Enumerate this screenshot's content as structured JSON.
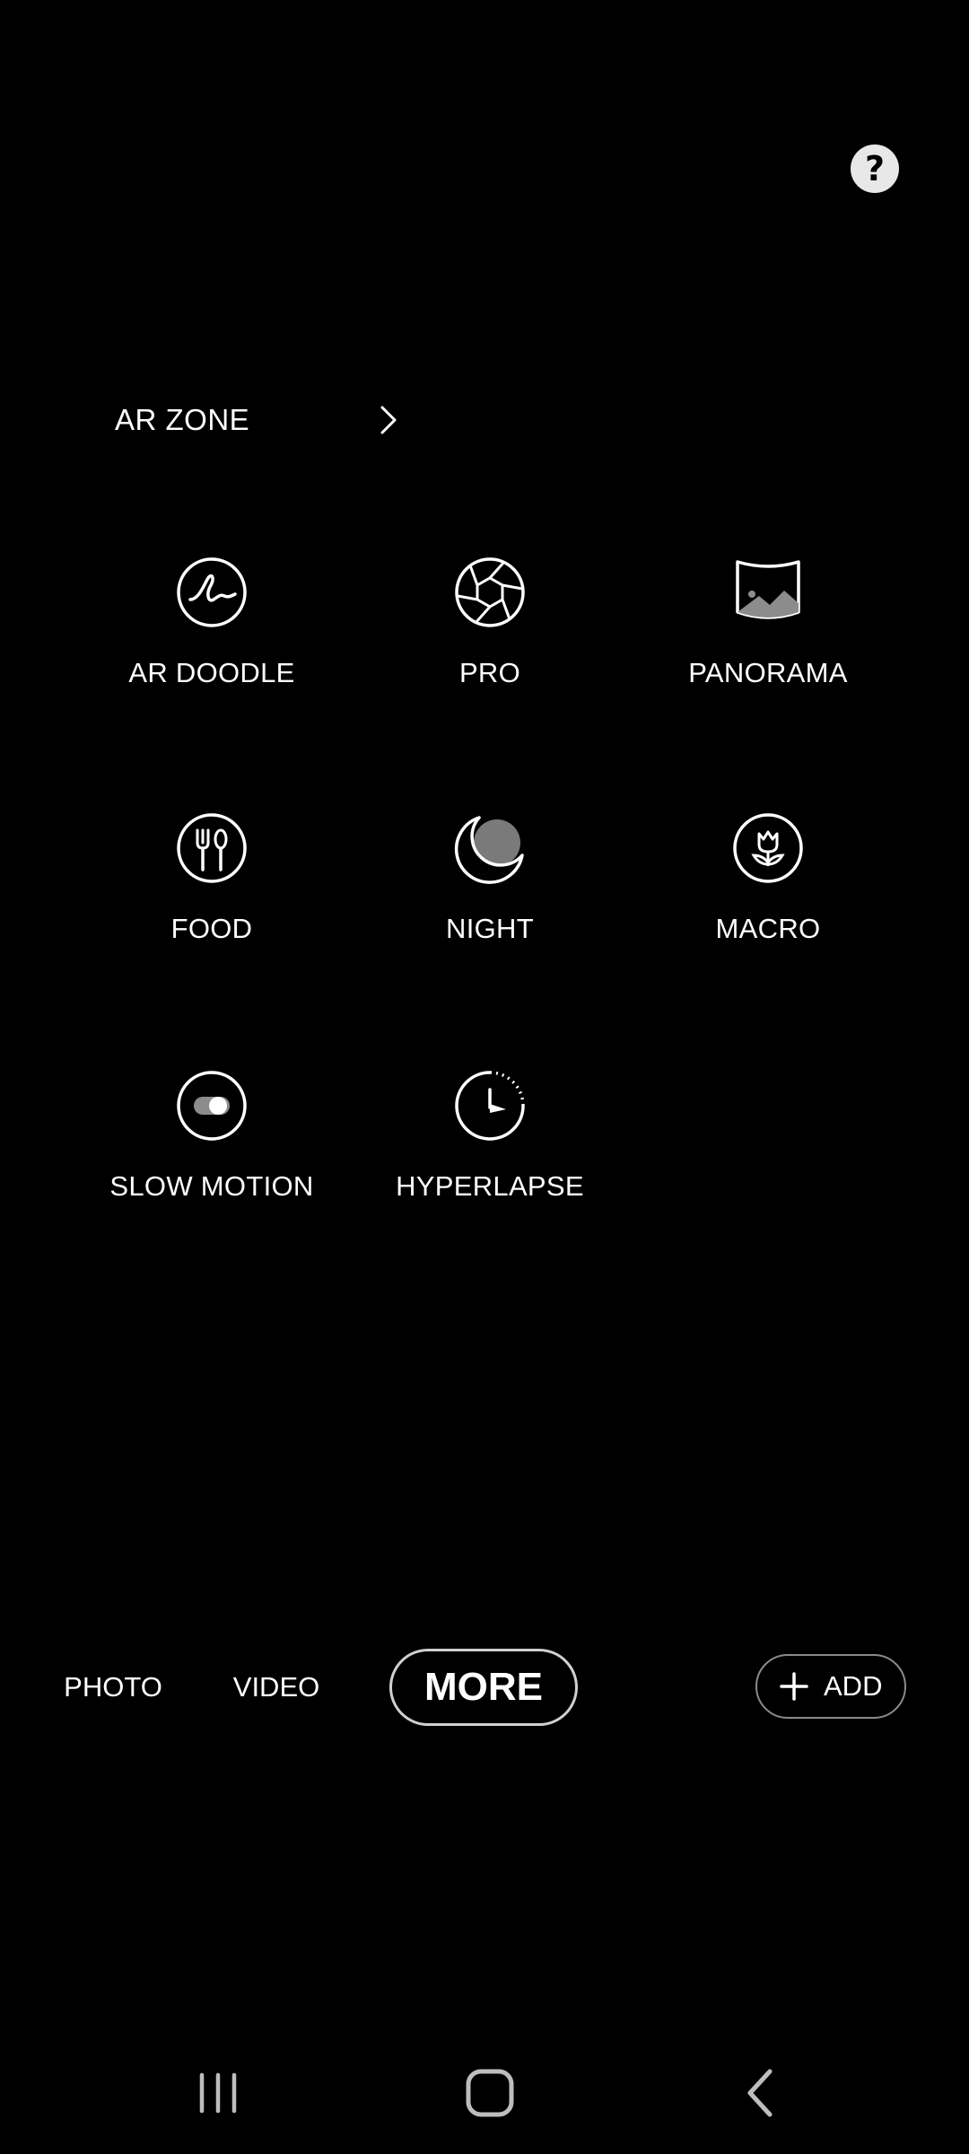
{
  "help": {
    "icon": "help-question-icon",
    "glyph": "?"
  },
  "ar_zone": {
    "label": "AR ZONE",
    "icon": "chevron-right-icon"
  },
  "modes": [
    {
      "label": "AR DOODLE",
      "icon": "ar-doodle-icon"
    },
    {
      "label": "PRO",
      "icon": "aperture-icon"
    },
    {
      "label": "PANORAMA",
      "icon": "panorama-icon"
    },
    {
      "label": "FOOD",
      "icon": "fork-spoon-icon"
    },
    {
      "label": "NIGHT",
      "icon": "moon-icon"
    },
    {
      "label": "MACRO",
      "icon": "flower-icon"
    },
    {
      "label": "SLOW MOTION",
      "icon": "slow-motion-icon"
    },
    {
      "label": "HYPERLAPSE",
      "icon": "timer-clock-icon"
    }
  ],
  "bottom_tabs": {
    "photo": "PHOTO",
    "video": "VIDEO",
    "more": "MORE",
    "selected": "MORE"
  },
  "add_button": {
    "label": "ADD",
    "icon": "plus-icon"
  },
  "nav_bar": {
    "recents_icon": "recent-apps-icon",
    "home_icon": "home-icon",
    "back_icon": "back-icon"
  },
  "colors": {
    "background": "#000000",
    "text": "#ffffff",
    "accent_border": "#d0d0d0"
  }
}
